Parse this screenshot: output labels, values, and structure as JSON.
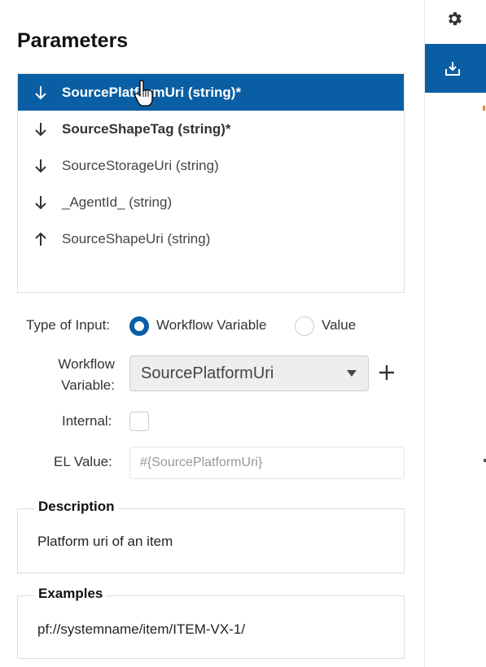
{
  "page_title": "Parameters",
  "parameters": [
    {
      "label": "SourcePlatformUri (string)*",
      "direction": "in",
      "selected": true,
      "required": true
    },
    {
      "label": "SourceShapeTag (string)*",
      "direction": "in",
      "selected": false,
      "required": true
    },
    {
      "label": "SourceStorageUri (string)",
      "direction": "in",
      "selected": false,
      "required": false
    },
    {
      "label": "_AgentId_ (string)",
      "direction": "in",
      "selected": false,
      "required": false
    },
    {
      "label": "SourceShapeUri (string)",
      "direction": "out",
      "selected": false,
      "required": false
    }
  ],
  "form": {
    "type_of_input_label": "Type of Input:",
    "option_workflow_variable": "Workflow Variable",
    "option_value": "Value",
    "selected_option": "Workflow Variable",
    "workflow_variable_label_line1": "Workflow",
    "workflow_variable_label_line2": "Variable:",
    "workflow_variable_value": "SourcePlatformUri",
    "internal_label": "Internal:",
    "internal_checked": false,
    "el_value_label": "EL Value:",
    "el_value_placeholder": "#{SourcePlatformUri}"
  },
  "description": {
    "legend": "Description",
    "text": "Platform uri of an item"
  },
  "examples": {
    "legend": "Examples",
    "text": "pf://systemname/item/ITEM-VX-1/"
  },
  "colors": {
    "accent": "#0a5fa4",
    "orange_indicator": "#f08a24"
  },
  "icons": {
    "settings": "gear-icon",
    "download": "download-tray-icon",
    "add": "plus-icon",
    "input_direction": "arrow-down-icon",
    "output_direction": "arrow-up-icon"
  }
}
